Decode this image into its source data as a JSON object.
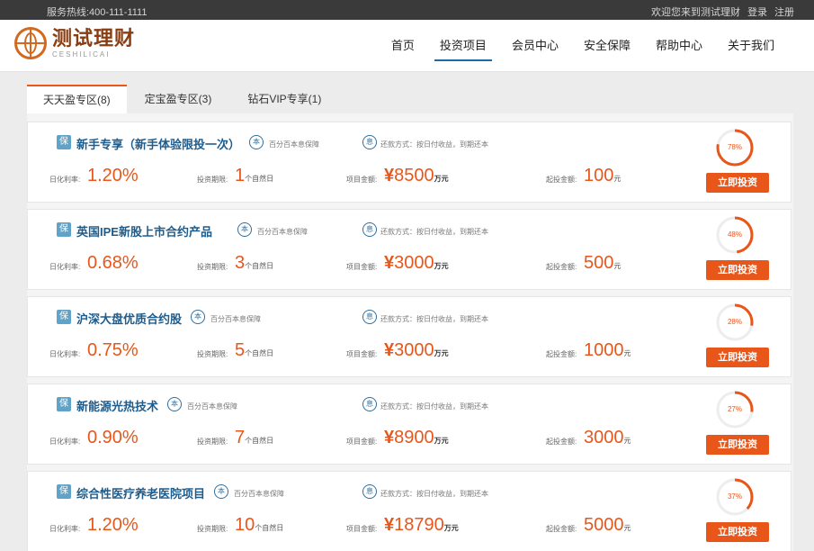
{
  "topbar": {
    "hotline": "服务热线:400-111-1111",
    "welcome": "欢迎您来到测试理财",
    "login": "登录",
    "register": "注册"
  },
  "logo": {
    "cn": "测试理财",
    "en": "CESHILICAI",
    "icon": "globe-icon"
  },
  "nav": [
    {
      "label": "首页"
    },
    {
      "label": "投资项目",
      "active": true
    },
    {
      "label": "会员中心"
    },
    {
      "label": "安全保障"
    },
    {
      "label": "帮助中心"
    },
    {
      "label": "关于我们"
    }
  ],
  "tabs": [
    {
      "label": "天天盈专区(8)",
      "active": true
    },
    {
      "label": "定宝盈专区(3)"
    },
    {
      "label": "钻石VIP专享(1)"
    }
  ],
  "colors": {
    "accent": "#e8561a",
    "title_blue": "#1e5c8c",
    "badge_blue": "#5fa3c9"
  },
  "labels": {
    "bao_badge": "保",
    "ben_badge": "本",
    "guarantee": "百分百本息保障",
    "repay_icon": "息",
    "repay": "还款方式：按日付收益，到期还本",
    "daily_rate": "日化利率:",
    "period": "投资期限:",
    "period_unit": "个自然日",
    "amount": "项目金额:",
    "yen": "¥",
    "wanyuan": "万元",
    "min": "起投金额:",
    "yuan": "元",
    "button": "立即投资"
  },
  "products": [
    {
      "title": "新手专享（新手体验限投一次）",
      "rate": "1.20%",
      "days": "1",
      "amount": "8500",
      "min": "100",
      "progress_text": "78%",
      "progress": 0.78
    },
    {
      "title": "英国IPE新股上市合约产品",
      "rate": "0.68%",
      "days": "3",
      "amount": "3000",
      "min": "500",
      "progress_text": "48%",
      "progress": 0.48
    },
    {
      "title": "沪深大盘优质合约股",
      "rate": "0.75%",
      "days": "5",
      "amount": "3000",
      "min": "1000",
      "progress_text": "28%",
      "progress": 0.28
    },
    {
      "title": "新能源光热技术",
      "rate": "0.90%",
      "days": "7",
      "amount": "8900",
      "min": "3000",
      "progress_text": "27%",
      "progress": 0.27
    },
    {
      "title": "综合性医疗养老医院项目",
      "rate": "1.20%",
      "days": "10",
      "amount": "18790",
      "min": "5000",
      "progress_text": "37%",
      "progress": 0.37
    }
  ]
}
